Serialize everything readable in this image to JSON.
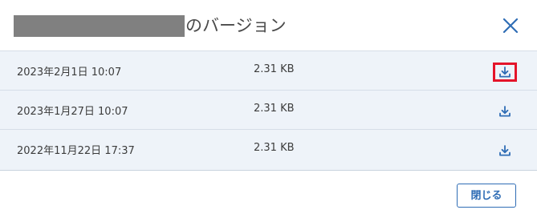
{
  "dialog": {
    "title_suffix": "のバージョン",
    "close_icon": "close-icon",
    "accent_color": "#2f6db5",
    "highlight_color": "#e4142a"
  },
  "versions": [
    {
      "date": "2023年2月1日 10:07",
      "size": "2.31 KB",
      "icon": "download-icon"
    },
    {
      "date": "2023年1月27日 10:07",
      "size": "2.31 KB",
      "icon": "download-icon"
    },
    {
      "date": "2022年11月22日 17:37",
      "size": "2.31 KB",
      "icon": "download-icon"
    }
  ],
  "footer": {
    "close_label": "閉じる"
  }
}
